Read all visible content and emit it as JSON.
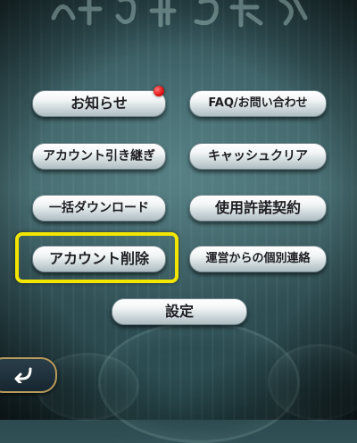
{
  "menu": {
    "news": "お知らせ",
    "faq": "FAQ/お問い合わせ",
    "account_transfer": "アカウント引き継ぎ",
    "cache_clear": "キャッシュクリア",
    "bulk_download": "一括ダウンロード",
    "terms": "使用許諾契約",
    "account_delete": "アカウント削除",
    "individual_contact": "運営からの個別連絡",
    "settings": "設定"
  },
  "icons": {
    "back": "back-arrow-icon",
    "notification": "notification-dot-icon"
  },
  "colors": {
    "highlight": "#f2e600",
    "notification_dot": "#e01818"
  }
}
